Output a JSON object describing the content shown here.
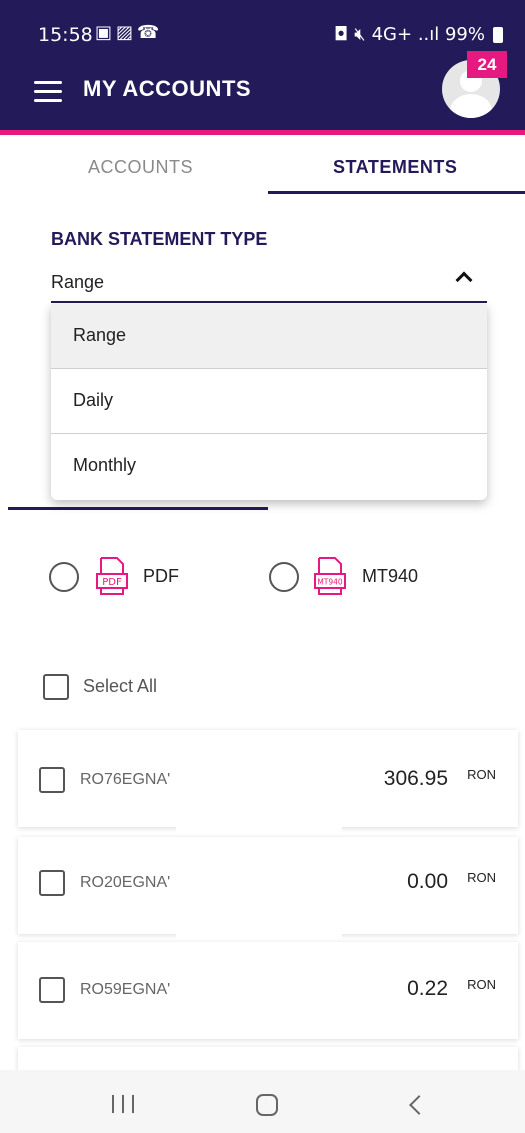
{
  "status_bar": {
    "time": "15:58",
    "left_icons": [
      "gallery-icon",
      "photo-icon",
      "missed-call-icon"
    ],
    "right_text": "4G+ ..ıl 99%",
    "battery": "99%"
  },
  "header": {
    "title": "MY ACCOUNTS",
    "notification_count": "24",
    "colors": {
      "bar": "#231a5a",
      "accent": "#e5197f"
    }
  },
  "tabs": [
    {
      "label": "ACCOUNTS",
      "active": false
    },
    {
      "label": "STATEMENTS",
      "active": true
    }
  ],
  "statement_type": {
    "label": "BANK STATEMENT TYPE",
    "selected": "Range",
    "options": [
      "Range",
      "Daily",
      "Monthly"
    ]
  },
  "formats": [
    {
      "label": "PDF",
      "icon_text": "PDF",
      "selected": false
    },
    {
      "label": "MT940",
      "icon_text": "MT940",
      "selected": false
    }
  ],
  "select_all": {
    "label": "Select All",
    "checked": false
  },
  "accounts": [
    {
      "iban": "RO76EGNA'",
      "amount": "306.95",
      "currency": "RON"
    },
    {
      "iban": "RO20EGNA'",
      "amount": "0.00",
      "currency": "RON"
    },
    {
      "iban": "RO59EGNA'",
      "amount": "0.22",
      "currency": "RON"
    }
  ]
}
